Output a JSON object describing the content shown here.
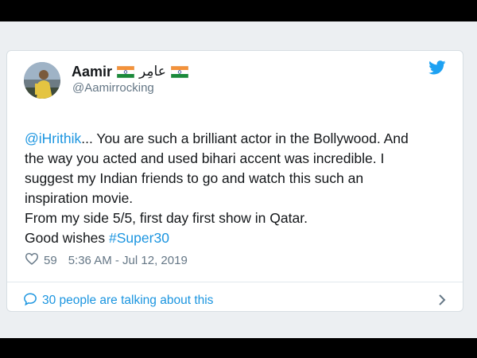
{
  "tweet": {
    "author_name": "Aamir",
    "author_urdu": "عامِر",
    "handle": "@Aamirrocking",
    "mention": "@iHrithik",
    "body_line1_rest": "... You are such a brilliant actor in the Bollywood.  And",
    "body_line2": "the way you acted and used bihari accent was incredible. I",
    "body_line3": "suggest my Indian friends to go and watch this such an",
    "body_line4": "inspiration  movie.",
    "body_line5": "From my side 5/5,  first day first show in Qatar.",
    "body_line6_prefix": "Good wishes ",
    "hashtag": "#Super30",
    "likes": "59",
    "timestamp": "5:36 AM - Jul 12, 2019",
    "talking": "30 people are talking about this"
  },
  "icons": {
    "flag": "india-flag-icon",
    "bird": "twitter-bird-icon",
    "heart": "heart-icon",
    "comment": "comment-bubble-icon",
    "chevron": "chevron-right-icon"
  },
  "colors": {
    "link": "#1b95e0",
    "text": "#14171a",
    "muted": "#657786",
    "frame_bg": "#eceff2"
  }
}
